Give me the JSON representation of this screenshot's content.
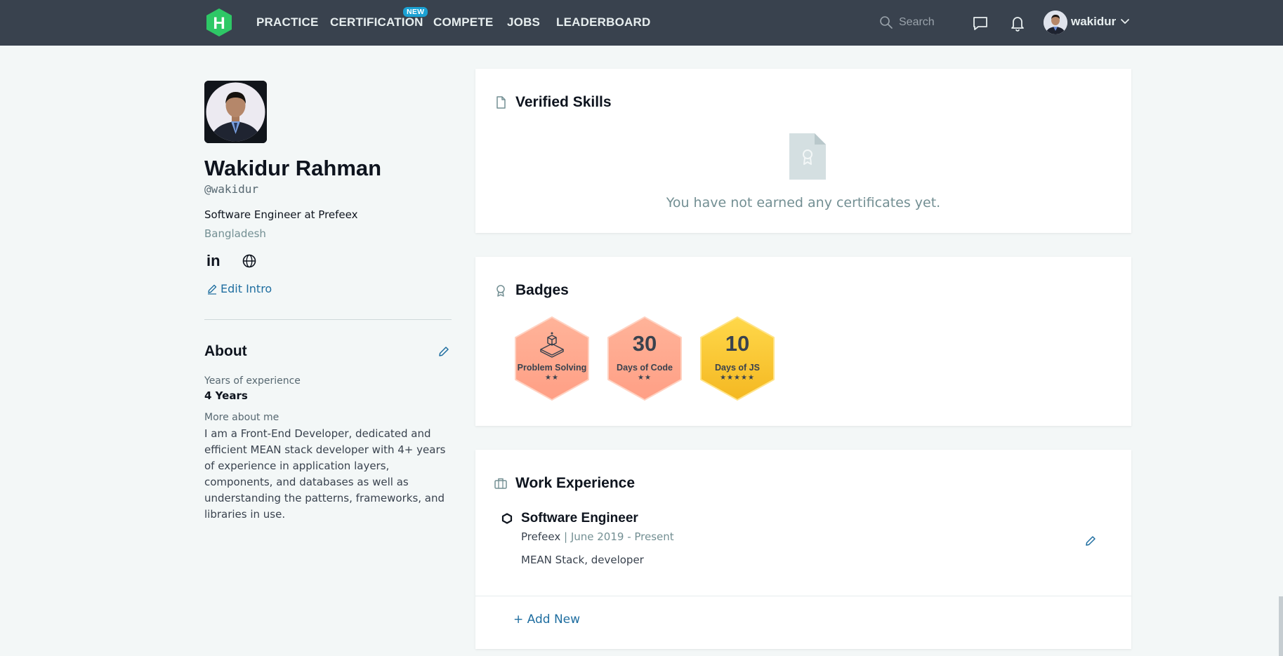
{
  "nav": {
    "items": [
      {
        "label": "PRACTICE"
      },
      {
        "label": "CERTIFICATION"
      },
      {
        "label": "COMPETE"
      },
      {
        "label": "JOBS"
      },
      {
        "label": "LEADERBOARD"
      }
    ],
    "new_badge": "NEW",
    "search_placeholder": "Search",
    "username": "wakidur",
    "brand_color": "#2ec866",
    "bar_color": "#39424e"
  },
  "profile": {
    "name": "Wakidur Rahman",
    "handle": "@wakidur",
    "job_title": "Software Engineer at Prefeex",
    "country": "Bangladesh",
    "linkedin_label": "in",
    "edit_intro": "Edit Intro"
  },
  "about": {
    "title": "About",
    "years_label": "Years of experience",
    "years_value": "4 Years",
    "more_label": "More about me",
    "more_text": "I am a Front-End Developer, dedicated and efficient MEAN stack developer with 4+ years of experience in application layers, components, and databases as well as understanding the patterns, frameworks, and libraries in use."
  },
  "verified_skills": {
    "title": "Verified Skills",
    "empty_text": "You have not earned any certificates yet."
  },
  "badges": {
    "title": "Badges",
    "items": [
      {
        "name": "Problem Solving",
        "number": "",
        "stars": "★★",
        "color": "#ffa98c"
      },
      {
        "name": "Days of Code",
        "number": "30",
        "stars": "★★",
        "color": "#ffa98c"
      },
      {
        "name": "Days of JS",
        "number": "10",
        "stars": "★★★★★",
        "color": "#f5c12a"
      }
    ]
  },
  "work": {
    "title": "Work Experience",
    "items": [
      {
        "role": "Software Engineer",
        "company": "Prefeex",
        "separator": "|",
        "dates": "June 2019 - Present",
        "description": "MEAN Stack, developer"
      }
    ],
    "add_new": "+ Add New"
  }
}
